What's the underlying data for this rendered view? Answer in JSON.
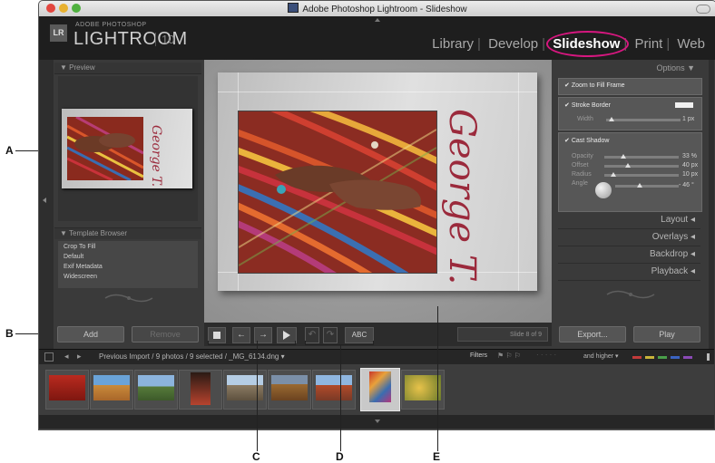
{
  "window": {
    "title": "Adobe Photoshop Lightroom - Slideshow"
  },
  "identity": {
    "badge": "LR",
    "brand_top": "ADOBE PHOTOSHOP",
    "brand": "LIGHTROOM",
    "version": "10"
  },
  "modules": [
    "Library",
    "Develop",
    "Slideshow",
    "Print",
    "Web"
  ],
  "left_panel": {
    "preview_header": "Preview",
    "template_header": "Template Browser",
    "templates": [
      "Crop To Fill",
      "Default",
      "Exif Metadata",
      "Widescreen"
    ],
    "add_label": "Add",
    "remove_label": "Remove"
  },
  "right_panel": {
    "options_header": "Options",
    "zoom_to_fill": "Zoom to Fill Frame",
    "stroke_border": "Stroke Border",
    "width_label": "Width",
    "width_value": "1 px",
    "cast_shadow": "Cast Shadow",
    "shadow": [
      {
        "label": "Opacity",
        "value": "33 %"
      },
      {
        "label": "Offset",
        "value": "40 px"
      },
      {
        "label": "Radius",
        "value": "10 px"
      },
      {
        "label": "Angle",
        "value": "- 46 °"
      }
    ],
    "sections": [
      "Layout",
      "Overlays",
      "Backdrop",
      "Playback"
    ],
    "export_label": "Export...",
    "play_label": "Play"
  },
  "slide": {
    "caption": "George T."
  },
  "toolbar": {
    "abc_label": "ABC",
    "slide_counter": "Slide 8 of 9"
  },
  "filterbar": {
    "path": "Previous Import / 9 photos / 9 selected / _MG_6104.dng",
    "filters_label": "Filters",
    "rating_label": "and higher"
  },
  "callouts": [
    "A",
    "B",
    "C",
    "D",
    "E"
  ],
  "colors": {
    "highlight_ring": "#d6177f",
    "slide_text": "#9b2a3c"
  }
}
